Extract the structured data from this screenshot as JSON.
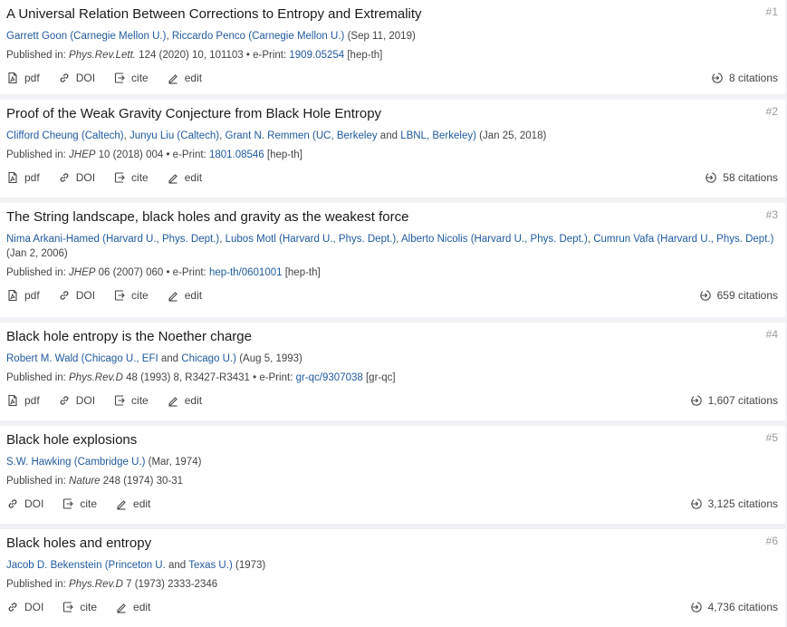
{
  "actions": {
    "pdf": "pdf",
    "doi": "DOI",
    "cite": "cite",
    "edit": "edit"
  },
  "papers": [
    {
      "rank": "#1",
      "title": "A Universal Relation Between Corrections to Entropy and Extremality",
      "authors": [
        {
          "name": "Garrett Goon",
          "affil": "Carnegie Mellon U."
        },
        {
          "name": "Riccardo Penco",
          "affil": "Carnegie Mellon U."
        }
      ],
      "date": "(Sep 11, 2019)",
      "pub_prefix": "Published in: ",
      "journal": "Phys.Rev.Lett.",
      "journal_ref": " 124 (2020) 10, 101103 • e-Print: ",
      "eprint": "1909.05254",
      "category": " [hep-th]",
      "citations": "8 citations"
    },
    {
      "rank": "#2",
      "title": "Proof of the Weak Gravity Conjecture from Black Hole Entropy",
      "authors_line": {
        "a1": "Clifford Cheung",
        "a1_affil": "Caltech",
        "a2": "Junyu Liu",
        "a2_affil": "Caltech",
        "a3": "Grant N. Remmen",
        "a3_affil1": "UC, Berkeley",
        "and": " and ",
        "a3_affil2": "LBNL, Berkeley"
      },
      "date": "(Jan 25, 2018)",
      "pub_prefix": "Published in: ",
      "journal": "JHEP",
      "journal_ref": " 10 (2018) 004 • e-Print: ",
      "eprint": "1801.08546",
      "category": " [hep-th]",
      "citations": "58 citations"
    },
    {
      "rank": "#3",
      "title": "The String landscape, black holes and gravity as the weakest force",
      "authors": [
        {
          "name": "Nima Arkani-Hamed",
          "affil": "Harvard U., Phys. Dept."
        },
        {
          "name": "Lubos Motl",
          "affil": "Harvard U., Phys. Dept."
        },
        {
          "name": "Alberto Nicolis",
          "affil": "Harvard U., Phys. Dept."
        },
        {
          "name": "Cumrun Vafa",
          "affil": "Harvard U., Phys. Dept."
        }
      ],
      "date": "(Jan 2, 2006)",
      "pub_prefix": "Published in: ",
      "journal": "JHEP",
      "journal_ref": " 06 (2007) 060 • e-Print: ",
      "eprint": "hep-th/0601001",
      "category": " [hep-th]",
      "citations": "659 citations"
    },
    {
      "rank": "#4",
      "title": "Black hole entropy is the Noether charge",
      "authors_line": {
        "a1": "Robert M. Wald",
        "a1_affil1": "Chicago U., EFI",
        "and": " and ",
        "a1_affil2": "Chicago U."
      },
      "date": "(Aug 5, 1993)",
      "pub_prefix": "Published in: ",
      "journal": "Phys.Rev.D",
      "journal_ref": " 48 (1993) 8, R3427-R3431 • e-Print: ",
      "eprint": "gr-qc/9307038",
      "category": " [gr-qc]",
      "citations": "1,607 citations"
    },
    {
      "rank": "#5",
      "title": "Black hole explosions",
      "authors": [
        {
          "name": "S.W. Hawking",
          "affil": "Cambridge U."
        }
      ],
      "date": "(Mar, 1974)",
      "pub_prefix": "Published in: ",
      "journal": "Nature",
      "journal_ref": " 248 (1974) 30-31",
      "citations": "3,125 citations"
    },
    {
      "rank": "#6",
      "title": "Black holes and entropy",
      "authors_line": {
        "a1": "Jacob D. Bekenstein",
        "a1_affil1": "Princeton U.",
        "and": " and ",
        "a1_affil2": "Texas U."
      },
      "date": "(1973)",
      "pub_prefix": "Published in: ",
      "journal": "Phys.Rev.D",
      "journal_ref": " 7 (1973) 2333-2346",
      "citations": "4,736 citations"
    }
  ]
}
